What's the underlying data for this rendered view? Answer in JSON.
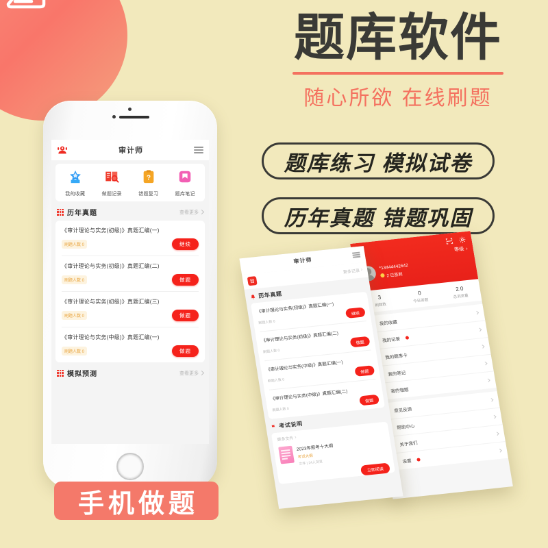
{
  "theme": {
    "bg": "#f2e9bc",
    "accent_red": "#f5221b",
    "accent_coral": "#f4796a",
    "headline_color": "#3a3a36"
  },
  "logo": {
    "icon": "stacked-books-icon"
  },
  "hero": {
    "headline": "题库软件",
    "subhead": "随心所欲  在线刷题"
  },
  "features": [
    {
      "label": "题库练习 模拟试卷"
    },
    {
      "label": "历年真题 错题巩固"
    }
  ],
  "bottom_badge": {
    "label": "手机做题"
  },
  "phone": {
    "app": {
      "nav": {
        "avatar_icon": "user-headset-icon",
        "title": "审计师",
        "menu_icon": "hamburger-icon"
      },
      "quick_actions": [
        {
          "label": "我的收藏",
          "icon": "star-badge-icon",
          "color": "#2f9bf5"
        },
        {
          "label": "做题记录",
          "icon": "book-search-icon",
          "color": "#ef3b2b"
        },
        {
          "label": "错题复习",
          "icon": "question-clipboard-icon",
          "color": "#f5a524"
        },
        {
          "label": "题库笔记",
          "icon": "note-icon",
          "color": "#f25fb4"
        }
      ],
      "sections": [
        {
          "title": "历年真题",
          "more_label": "查看更多",
          "icon": "grid-dots-icon",
          "items": [
            {
              "title": "《审计理论与实务(初级)》真题汇编(一)",
              "tag": "刷题人数 0",
              "button": "继续"
            },
            {
              "title": "《审计理论与实务(初级)》真题汇编(二)",
              "tag": "刷题人数 0",
              "button": "做题"
            },
            {
              "title": "《审计理论与实务(初级)》真题汇编(三)",
              "tag": "刷题人数 0",
              "button": "做题"
            },
            {
              "title": "《审计理论与实务(中级)》真题汇编(一)",
              "tag": "刷题人数 0",
              "button": "做题"
            }
          ]
        },
        {
          "title": "模拟预测",
          "more_label": "查看更多",
          "icon": "grid-dots-icon",
          "items": []
        }
      ]
    }
  },
  "tilted_screenshots": {
    "middle": {
      "nav": {
        "title": "审计师",
        "menu_icon": "hamburger-icon"
      },
      "badge_icon": "app-badge-icon",
      "badge_more": "更多记录",
      "section": {
        "title": "历年真题",
        "icon": "bell-icon"
      },
      "items": [
        {
          "title": "《审计理论与实务(初级)》真题汇编(一)",
          "tag": "刷题人数 0",
          "button": "继续"
        },
        {
          "title": "《审计理论与实务(初级)》真题汇编(二)",
          "tag": "刷题人数 0",
          "button": "做题"
        },
        {
          "title": "《审计理论与实务(中级)》真题汇编(一)",
          "tag": "刷题人数 0",
          "button": "做题"
        },
        {
          "title": "《审计理论与实务(中级)》真题汇编(二)",
          "tag": "刷题人数 0",
          "button": "做题"
        }
      ],
      "doc_section": {
        "title": "考试说明",
        "more_label": "更多文件",
        "doc_name": "2023年报考十大纲",
        "doc_tag": "考试大纲",
        "doc_sub": "文件 | 24人浏览",
        "read_button": "立即阅读"
      }
    },
    "right": {
      "scan_icon": "scan-icon",
      "gear_icon": "gear-icon",
      "level_label": "等级",
      "username": "*13444442642",
      "coin_label": "2 已签到",
      "stats": [
        {
          "value": "3",
          "label": "刷题数"
        },
        {
          "value": "0",
          "label": "今日答题"
        },
        {
          "value": "2.0",
          "label": "总浏览量"
        }
      ],
      "menu": [
        {
          "label": "我的收藏",
          "icon": "heart-icon",
          "badge": false
        },
        {
          "label": "我的记录",
          "icon": "clock-icon",
          "badge": true
        },
        {
          "label": "我的题库卡",
          "icon": "card-icon",
          "badge": false
        },
        {
          "label": "我的笔记",
          "icon": "note-icon",
          "badge": false
        },
        {
          "label": "我的错题",
          "icon": "error-icon",
          "badge": false
        },
        {
          "label": "意见反馈",
          "icon": "feedback-icon",
          "badge": false
        },
        {
          "label": "帮助中心",
          "icon": "help-icon",
          "badge": false
        },
        {
          "label": "关于我们",
          "icon": "info-icon",
          "badge": false
        },
        {
          "label": "设置",
          "icon": "gear-icon",
          "badge": true
        }
      ]
    }
  }
}
